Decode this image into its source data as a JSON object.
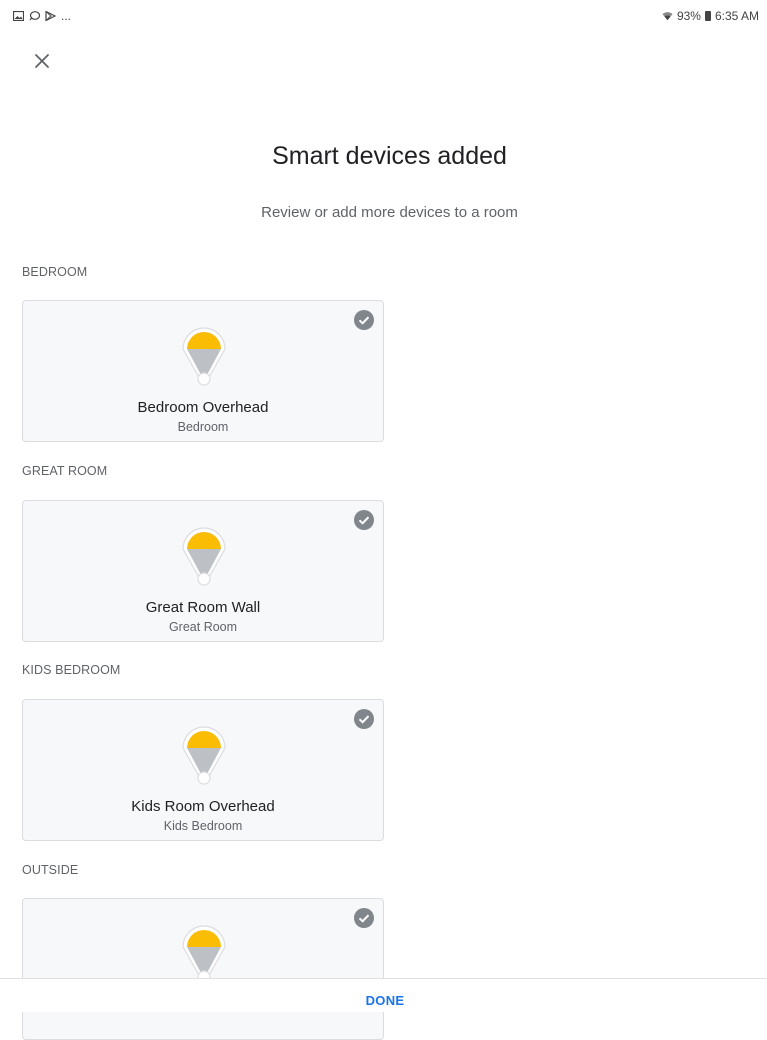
{
  "status_bar": {
    "notifications": [
      "gallery-icon",
      "chat-icon",
      "play-store-icon"
    ],
    "more": "...",
    "battery": "93%",
    "time": "6:35 AM"
  },
  "header": {
    "title": "Smart devices added",
    "subtitle": "Review or add more devices to a room"
  },
  "sections": [
    {
      "label": "BEDROOM",
      "device": {
        "name": "Bedroom Overhead",
        "room": "Bedroom",
        "checked": true
      }
    },
    {
      "label": "GREAT ROOM",
      "device": {
        "name": "Great Room Wall",
        "room": "Great Room",
        "checked": true
      }
    },
    {
      "label": "KIDS BEDROOM",
      "device": {
        "name": "Kids Room Overhead",
        "room": "Kids Bedroom",
        "checked": true
      }
    },
    {
      "label": "OUTSIDE",
      "device": {
        "name": "",
        "room": "",
        "checked": true
      }
    }
  ],
  "footer": {
    "done_label": "DONE"
  },
  "colors": {
    "accent": "#1a73e8",
    "bulb": "#fbbc04",
    "check": "#80868b"
  }
}
